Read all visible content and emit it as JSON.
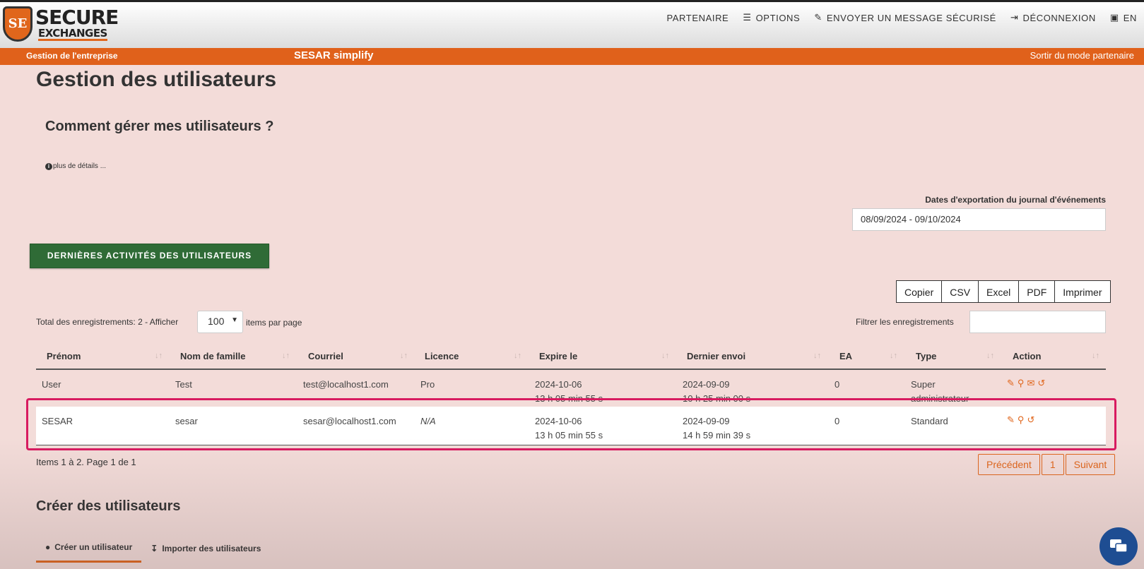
{
  "header": {
    "logo": {
      "line1": "SECURE",
      "line2": "EXCHANGES",
      "mark": "SE"
    },
    "nav": [
      {
        "label": "PARTENAIRE",
        "icon": ""
      },
      {
        "label": "OPTIONS",
        "icon": "☰"
      },
      {
        "label": "ENVOYER UN MESSAGE SÉCURISÉ",
        "icon": "✎"
      },
      {
        "label": "DÉCONNEXION",
        "icon": "⇥"
      },
      {
        "label": "EN",
        "icon": "▣"
      }
    ]
  },
  "partner_bar": {
    "left": "Gestion de l'entreprise",
    "company": "SESAR simplify",
    "exit": "Sortir du mode partenaire"
  },
  "page": {
    "title": "Gestion des utilisateurs",
    "help_title": "Comment gérer mes utilisateurs ?",
    "details_link": "plus de détails ..."
  },
  "export": {
    "label": "Dates d'exportation du journal d'événements",
    "value": "08/09/2024 - 09/10/2024"
  },
  "activity_button": "DERNIÈRES ACTIVITÉS DES UTILISATEURS",
  "export_buttons": [
    "Copier",
    "CSV",
    "Excel",
    "PDF",
    "Imprimer"
  ],
  "table_controls": {
    "total_text": "Total des enregistrements: 2 - Afficher",
    "page_size": "100",
    "items_per_page": "items par page",
    "filter_label": "Filtrer les enregistrements",
    "filter_value": ""
  },
  "table": {
    "columns": [
      "Prénom",
      "Nom de famille",
      "Courriel",
      "Licence",
      "Expire le",
      "Dernier envoi",
      "EA",
      "Type",
      "Action"
    ],
    "rows": [
      {
        "prenom": "User",
        "nom": "Test",
        "courriel": "test@localhost1.com",
        "licence": "Pro",
        "expire_date": "2024-10-06",
        "expire_time": "13 h 05 min 55 s",
        "envoi_date": "2024-09-09",
        "envoi_time": "10 h 25 min 00 s",
        "ea": "0",
        "type_line1": "Super",
        "type_line2": "administrateur",
        "actions": [
          "user-edit-icon",
          "award-icon",
          "envelope-icon",
          "history-icon"
        ]
      },
      {
        "prenom": "SESAR",
        "nom": "sesar",
        "courriel": "sesar@localhost1.com",
        "licence": "N/A",
        "expire_date": "2024-10-06",
        "expire_time": "13 h 05 min 55 s",
        "envoi_date": "2024-09-09",
        "envoi_time": "14 h 59 min 39 s",
        "ea": "0",
        "type_line1": "Standard",
        "type_line2": "",
        "actions": [
          "user-edit-icon",
          "award-icon",
          "history-icon"
        ]
      }
    ]
  },
  "pagination": {
    "info": "Items 1 à 2. Page 1 de 1",
    "prev": "Précédent",
    "current": "1",
    "next": "Suivant"
  },
  "create": {
    "title": "Créer des utilisateurs",
    "tabs": [
      "Créer un utilisateur",
      "Importer des utilisateurs"
    ]
  },
  "colors": {
    "accent": "#e0611b",
    "green": "#2f6b36",
    "highlight": "#d81b60",
    "background": "#f3dcd9"
  }
}
